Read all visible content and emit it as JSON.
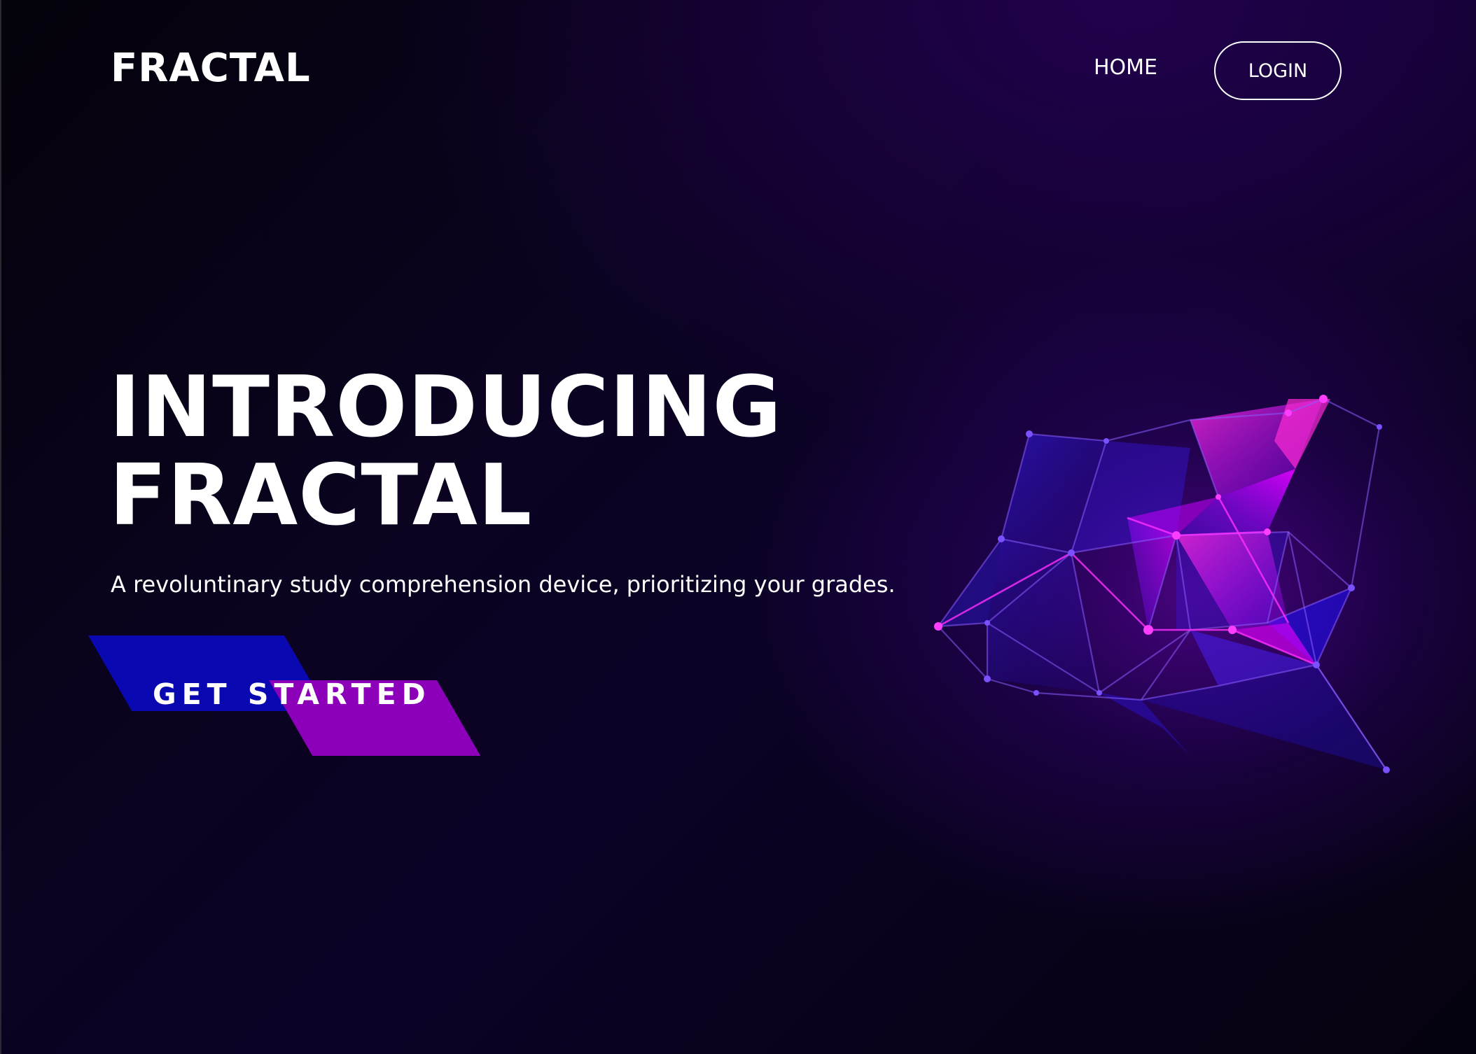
{
  "header": {
    "logo": "FRACTAL",
    "nav": {
      "home_label": "HOME",
      "login_label": "LOGIN"
    }
  },
  "hero": {
    "title_line1": "INTRODUCING",
    "title_line2": "FRACTAL",
    "subtitle": "A revoluntinary study comprehension device, prioritizing your grades.",
    "cta_label": "GET STARTED"
  },
  "colors": {
    "background_dark": "#05020f",
    "background_purple": "#1a0540",
    "cta_blue": "#0a08b0",
    "cta_purple": "#8b00b8",
    "mesh_magenta": "#e000ff",
    "mesh_blue": "#3a1cff"
  },
  "icons": {
    "hero_graphic": "fractal-mesh-illustration"
  }
}
